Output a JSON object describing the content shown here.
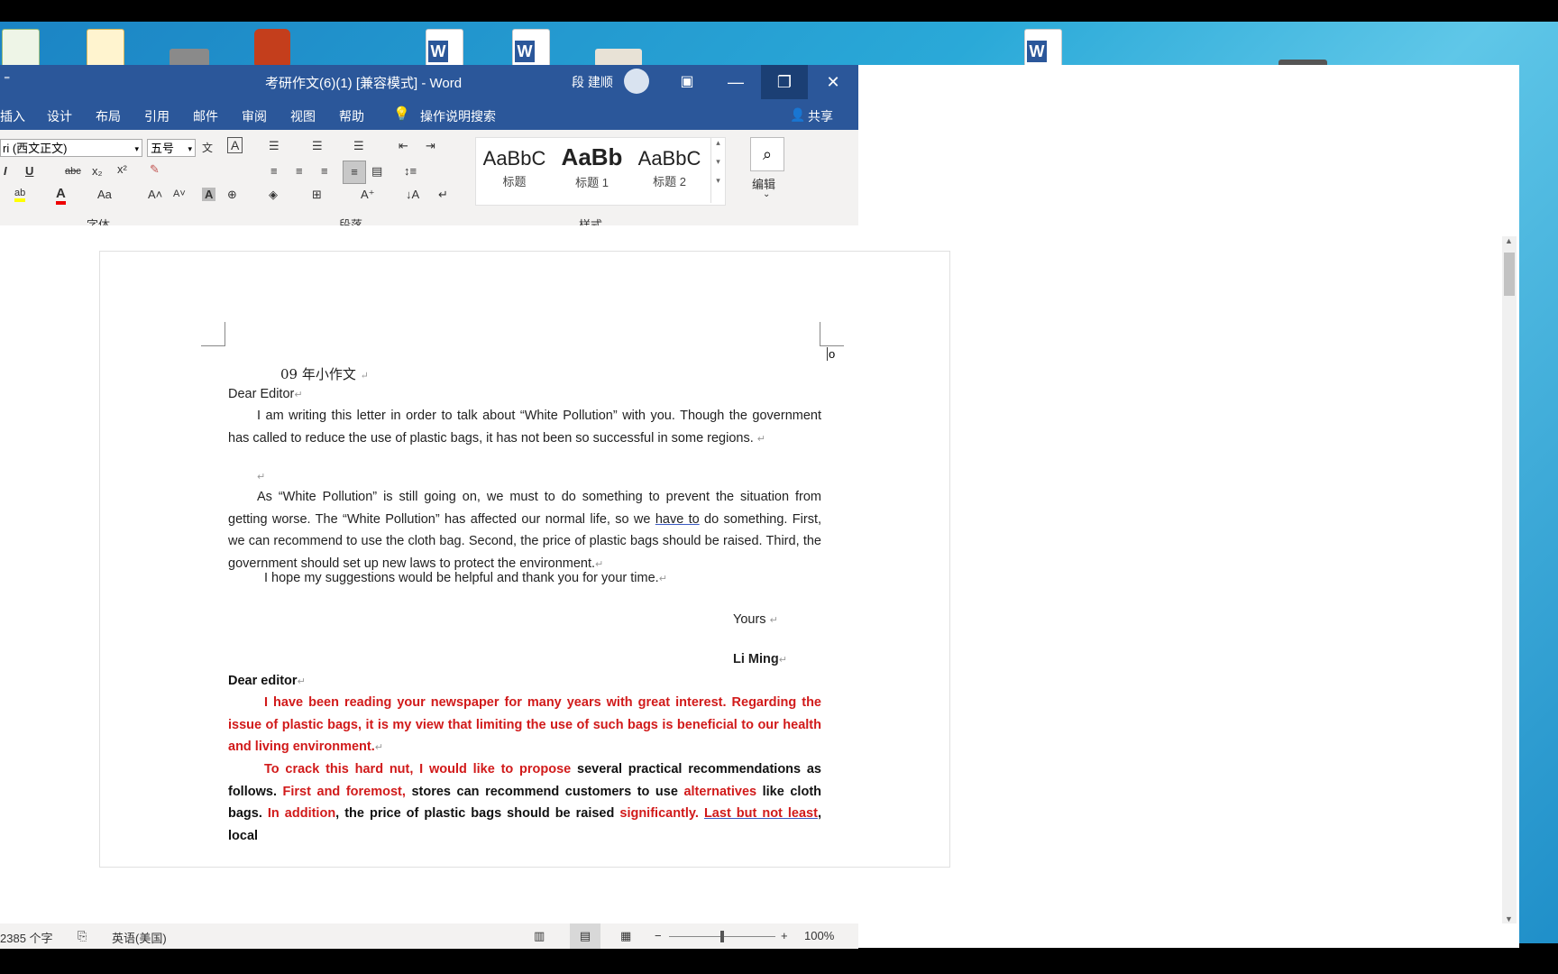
{
  "window": {
    "title": "考研作文(6)(1) [兼容模式]  -  Word",
    "user_name": "段 建顺",
    "min_glyph": "—",
    "max_glyph": "❐",
    "close_glyph": "✕"
  },
  "menu": [
    "插入",
    "设计",
    "布局",
    "引用",
    "邮件",
    "审阅",
    "视图",
    "帮助"
  ],
  "tell_me": "操作说明搜索",
  "share": "共享",
  "ribbon": {
    "font_name": "ri (西文正文)",
    "font_size": "五号",
    "group_font": "字体",
    "group_paragraph": "段落",
    "group_styles": "样式",
    "edit_label": "编辑",
    "styles": [
      {
        "sample": "AaBbC",
        "name": "标题"
      },
      {
        "sample": "AaBb",
        "name": "标题 1"
      },
      {
        "sample": "AaBbC",
        "name": "标题 2"
      }
    ],
    "btn_italic": "I",
    "btn_underline": "U",
    "btn_strike": "abc",
    "btn_sub": "x₂",
    "btn_sup": "x²",
    "btn_aa": "Aa",
    "btn_font_color": "A"
  },
  "document": {
    "header_mark": "o",
    "title": "09 年小作文",
    "salutation1": "Dear Editor",
    "p1": "I am writing this letter in order to talk about “White Pollution” with you. Though the government has called to reduce the use of plastic bags, it has not been so successful in some regions.",
    "p2_a": "As “White Pollution” is still going on, we must to do something to prevent the situation from getting worse. The “White Pollution” has affected our normal life, so we ",
    "p2_ul": "have to",
    "p2_b": " do something. First, we can recommend to use the cloth bag. Second, the price of plastic bags should be raised. Third, the government should set up new laws to protect the environment.",
    "p3": "I hope my suggestions would be helpful and thank you for your time.",
    "closing": "Yours",
    "signature": "Li Ming",
    "salutation2": "Dear editor",
    "p4": "I have been reading your newspaper for many years with great interest. Regarding the issue of plastic bags, it is my view that limiting the use of such bags is beneficial to our health and living environment.",
    "p5_r1": "To crack this hard nut, I would like to propose",
    "p5_b1": " several practical recommendations as follows. ",
    "p5_r2": "First and foremost,",
    "p5_b2": " stores can recommend customers to use ",
    "p5_r3": "alternatives",
    "p5_b3": " like cloth bags. ",
    "p5_r4": "In addition",
    "p5_b4": ", the price of plastic bags should be raised ",
    "p5_r5": "significantly.",
    "p5_b5": " ",
    "p5_r6": "Last but not least",
    "p5_b6": ", local"
  },
  "status": {
    "word_count": "2385 个字",
    "language": "英语(美国)",
    "zoom": "100%",
    "zoom_minus": "−",
    "zoom_plus": "+"
  },
  "colors": {
    "word_blue": "#2b579a",
    "red_text": "#d11a1a"
  }
}
